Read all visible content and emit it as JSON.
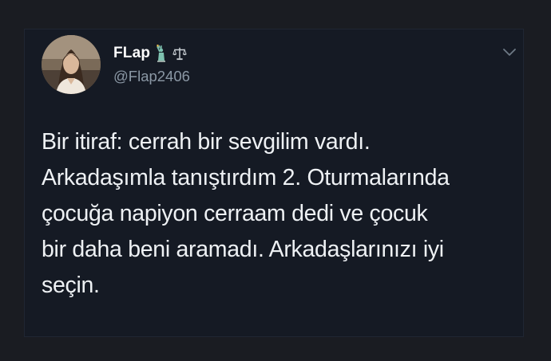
{
  "tweet": {
    "author": {
      "display_name": "FLap",
      "handle": "@Flap2406",
      "name_emojis": [
        "statue-of-liberty",
        "balance-scale"
      ]
    },
    "text": "Bir itiraf: cerrah bir sevgilim vardı.\nArkadaşımla tanıştırdım 2. Oturmalarında\nçocuğa napiyon cerraam dedi ve çocuk\nbir daha beni aramadı. Arkadaşlarınızı iyi\nseçin."
  },
  "colors": {
    "page_background": "#1a1c22",
    "card_background": "#151a24",
    "text_primary": "#eef1f4",
    "text_secondary": "#8b98a5"
  }
}
